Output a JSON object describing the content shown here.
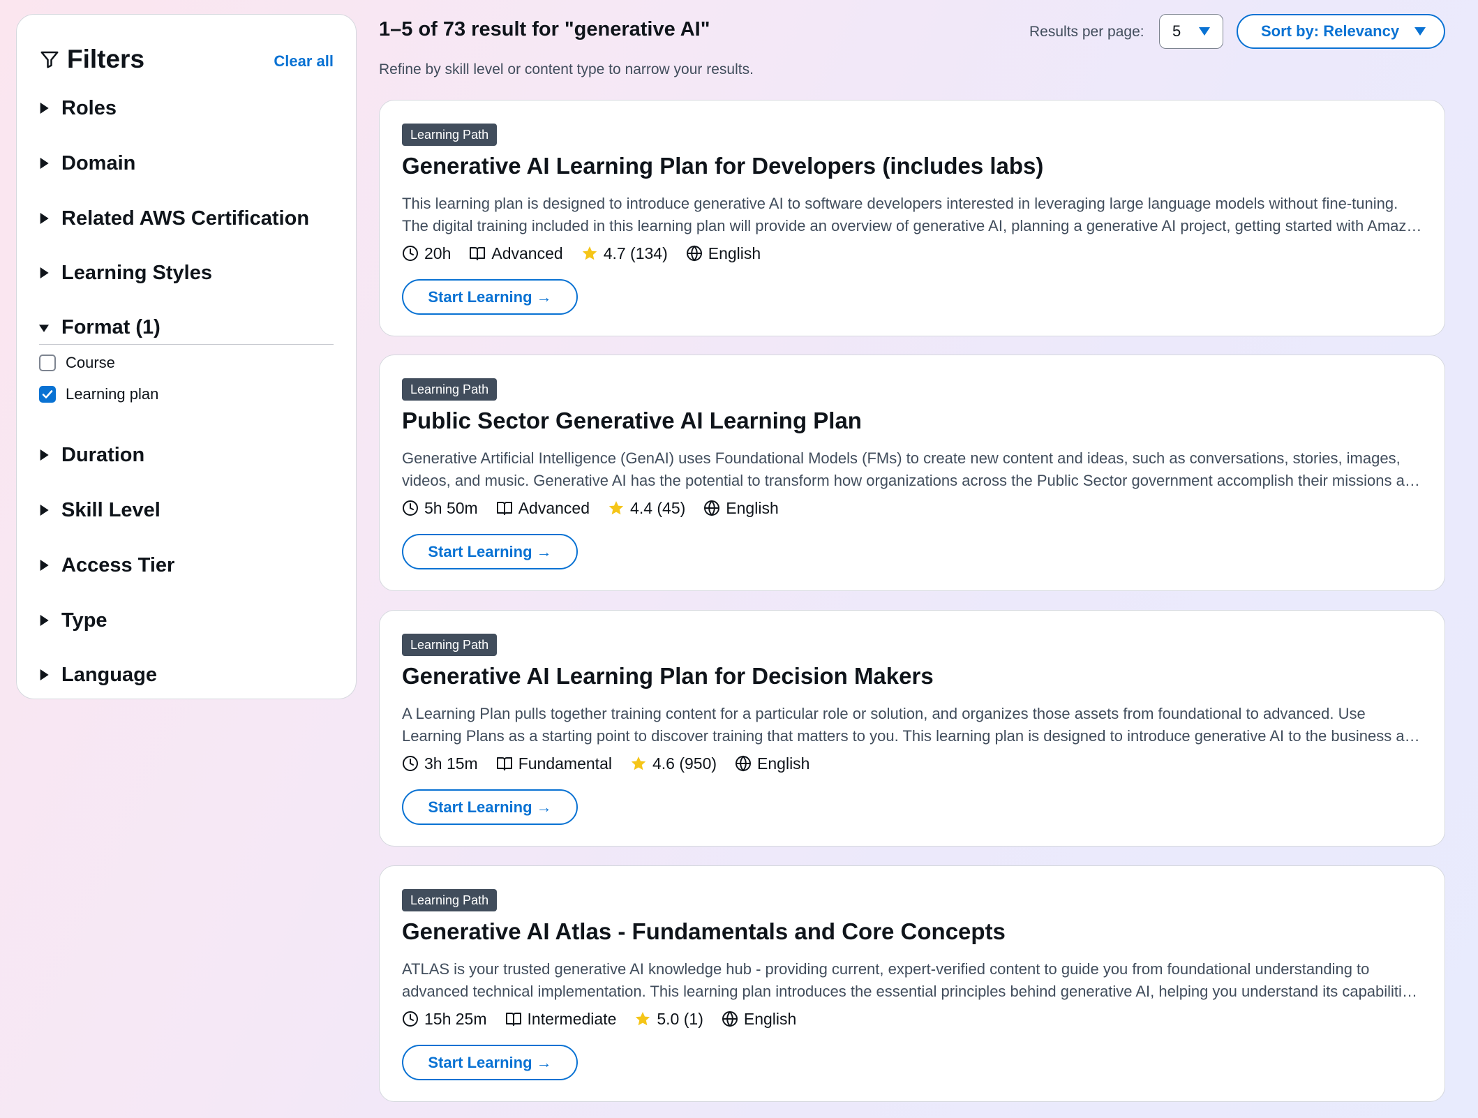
{
  "sidebar": {
    "title": "Filters",
    "clear_all": "Clear all",
    "facets": {
      "roles": "Roles",
      "domain": "Domain",
      "certification": "Related AWS Certification",
      "learning_styles": "Learning Styles",
      "format": "Format (1)",
      "duration": "Duration",
      "skill_level": "Skill Level",
      "access_tier": "Access Tier",
      "type": "Type",
      "language": "Language"
    },
    "format_options": [
      {
        "label": "Course",
        "checked": false
      },
      {
        "label": "Learning plan",
        "checked": true
      }
    ]
  },
  "header": {
    "results_title": "1–5 of 73 result for \"generative AI\"",
    "subtitle": "Refine by skill level or content type to narrow your results.",
    "results_per_page_label": "Results per page:",
    "results_per_page_value": "5",
    "sort_label": "Sort by: Relevancy"
  },
  "cards": [
    {
      "badge": "Learning Path",
      "title": "Generative AI Learning Plan for Developers (includes labs)",
      "description": "This learning plan is designed to introduce generative AI to software developers interested in leveraging large language models without fine-tuning. The digital training included in this learning plan will provide an overview of generative AI, planning a generative AI project, getting started with Amazon Bedrock, and more.",
      "duration": "20h",
      "level": "Advanced",
      "rating": "4.7 (134)",
      "language": "English",
      "cta": "Start Learning →"
    },
    {
      "badge": "Learning Path",
      "title": "Public Sector Generative AI Learning Plan",
      "description": "Generative Artificial Intelligence (GenAI) uses Foundational Models (FMs) to create new content and ideas, such as conversations, stories, images, videos, and music. Generative AI has the potential to transform how organizations across the Public Sector government accomplish their missions and serve citizens.",
      "duration": "5h 50m",
      "level": "Advanced",
      "rating": "4.4 (45)",
      "language": "English",
      "cta": "Start Learning →"
    },
    {
      "badge": "Learning Path",
      "title": "Generative AI Learning Plan for Decision Makers",
      "description": "A Learning Plan pulls together training content for a particular role or solution, and organizes those assets from foundational to advanced. Use Learning Plans as a starting point to discover training that matters to you. This learning plan is designed to introduce generative AI to the business and technical decision makers.",
      "duration": "3h 15m",
      "level": "Fundamental",
      "rating": "4.6 (950)",
      "language": "English",
      "cta": "Start Learning →"
    },
    {
      "badge": "Learning Path",
      "title": "Generative AI Atlas - Fundamentals and Core Concepts",
      "description": "ATLAS is your trusted generative AI knowledge hub - providing current, expert-verified content to guide you from foundational understanding to advanced technical implementation. This learning plan introduces the essential principles behind generative AI, helping you understand its capabilities and limitations.",
      "duration": "15h 25m",
      "level": "Intermediate",
      "rating": "5.0 (1)",
      "language": "English",
      "cta": "Start Learning →"
    }
  ],
  "icons": {
    "filter": "funnel-icon",
    "caret_closed": "caret-right-icon",
    "caret_open": "caret-down-icon",
    "duration": "clock-icon",
    "level": "book-icon",
    "rating": "star-icon",
    "language": "globe-icon"
  },
  "colors": {
    "accent": "#0972d3",
    "badge": "#414d5c",
    "star": "#f5c518",
    "text": "#0f141a"
  }
}
